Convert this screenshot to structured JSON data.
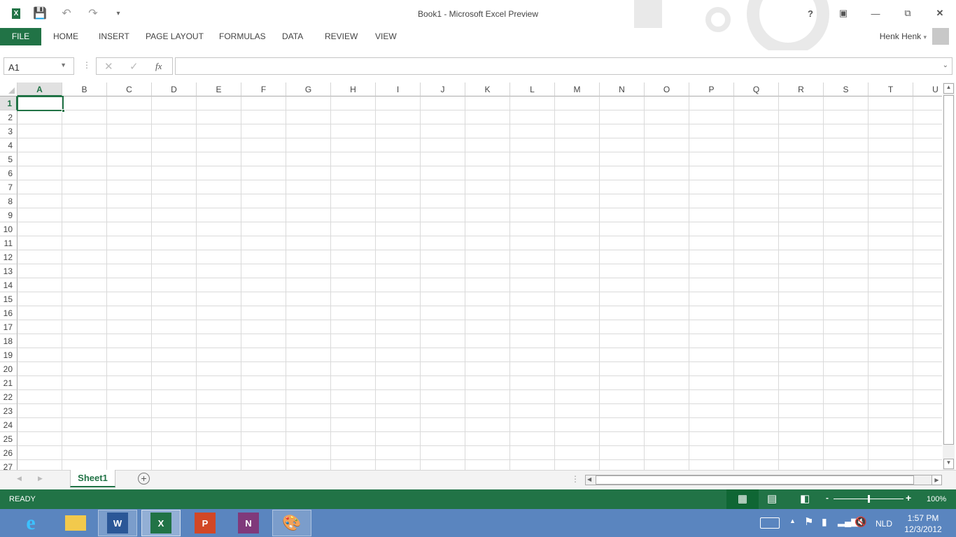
{
  "window": {
    "title": "Book1 - Microsoft Excel Preview",
    "help": "?",
    "user": "Henk Henk"
  },
  "ribbon": {
    "tabs": [
      "FILE",
      "HOME",
      "INSERT",
      "PAGE LAYOUT",
      "FORMULAS",
      "DATA",
      "REVIEW",
      "VIEW"
    ]
  },
  "formula_bar": {
    "name_box": "A1",
    "fx": "fx",
    "value": ""
  },
  "grid": {
    "columns": [
      "A",
      "B",
      "C",
      "D",
      "E",
      "F",
      "G",
      "H",
      "I",
      "J",
      "K",
      "L",
      "M",
      "N",
      "O",
      "P",
      "Q",
      "R",
      "S",
      "T",
      "U"
    ],
    "row_count": 27,
    "selected": "A1"
  },
  "sheets": {
    "tabs": [
      "Sheet1"
    ],
    "add": "+"
  },
  "status": {
    "mode": "READY",
    "zoom": "100%",
    "zoom_level": 100
  },
  "taskbar": {
    "language": "NLD",
    "time": "1:57 PM",
    "date": "12/3/2012",
    "apps": [
      "internet-explorer",
      "file-explorer",
      "word",
      "excel",
      "powerpoint",
      "onenote",
      "paint"
    ]
  },
  "colors": {
    "accent": "#217346",
    "taskbar": "#5a85bf"
  }
}
